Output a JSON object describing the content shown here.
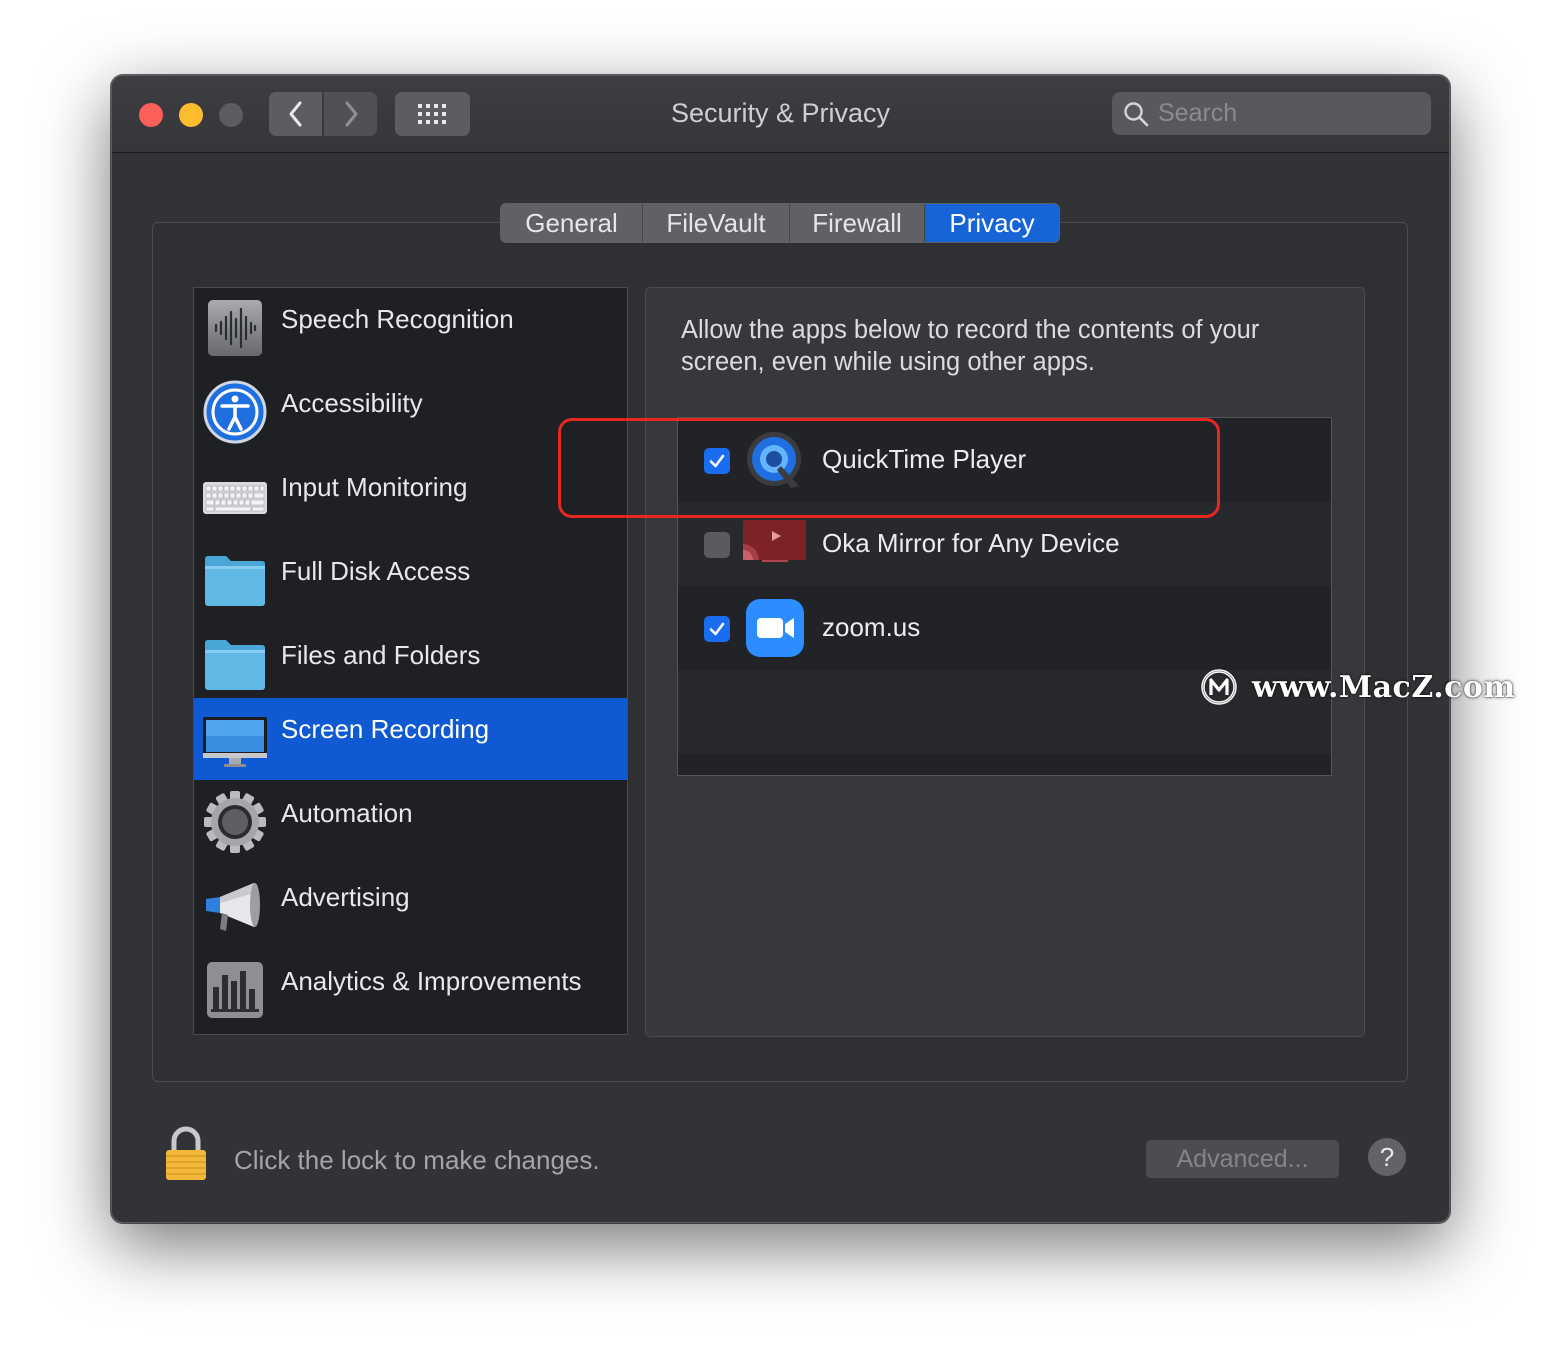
{
  "window": {
    "title": "Security & Privacy"
  },
  "search": {
    "placeholder": "Search"
  },
  "tabs": [
    {
      "label": "General",
      "active": false
    },
    {
      "label": "FileVault",
      "active": false
    },
    {
      "label": "Firewall",
      "active": false
    },
    {
      "label": "Privacy",
      "active": true
    }
  ],
  "sidebar": {
    "items": [
      {
        "label": "Speech Recognition",
        "icon": "waveform-icon"
      },
      {
        "label": "Accessibility",
        "icon": "accessibility-icon"
      },
      {
        "label": "Input Monitoring",
        "icon": "keyboard-icon"
      },
      {
        "label": "Full Disk Access",
        "icon": "folder-icon"
      },
      {
        "label": "Files and Folders",
        "icon": "folder-icon"
      },
      {
        "label": "Screen Recording",
        "icon": "display-icon",
        "selected": true
      },
      {
        "label": "Automation",
        "icon": "gear-icon"
      },
      {
        "label": "Advertising",
        "icon": "megaphone-icon"
      },
      {
        "label": "Analytics & Improvements",
        "icon": "bar-chart-icon"
      }
    ]
  },
  "panel": {
    "description": "Allow the apps below to record the contents of your screen, even while using other apps.",
    "apps": [
      {
        "name": "QuickTime Player",
        "checked": true,
        "icon": "quicktime-icon"
      },
      {
        "name": "Oka Mirror for Any Device",
        "checked": false,
        "icon": "oka-mirror-icon"
      },
      {
        "name": "zoom.us",
        "checked": true,
        "icon": "zoom-icon"
      }
    ]
  },
  "footer": {
    "lock_text": "Click the lock to make changes.",
    "advanced_label": "Advanced...",
    "help_label": "?"
  },
  "watermark": {
    "text": "www.MacZ.com"
  },
  "colors": {
    "accent": "#1764d6",
    "selection": "#0f5ad2",
    "highlight_border": "#e8271f",
    "window_bg": "#323336"
  }
}
